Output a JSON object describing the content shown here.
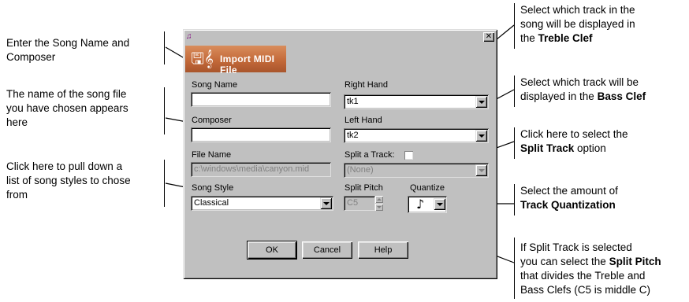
{
  "annotations": {
    "song_name": [
      "Enter the Song Name and",
      "Composer"
    ],
    "file_name": [
      "The name of the song file",
      "you have chosen appears",
      "here"
    ],
    "song_style": [
      "Click here to pull down a",
      "list of song styles to chose",
      "from"
    ],
    "treble_clef": {
      "line1": "Select which track in the",
      "line2": "song will be displayed in",
      "line3_prefix": "the ",
      "line3_bold": "Treble Clef"
    },
    "bass_clef": {
      "line1": "Select which track will be",
      "line2_prefix": "displayed in the ",
      "line2_bold": "Bass Clef"
    },
    "split_track": {
      "line1": "Click here to select the",
      "line2_bold": "Split Track",
      "line2_suffix": " option"
    },
    "quantize": {
      "line1": "Select the amount of",
      "line2_bold": "Track Quantization"
    },
    "split_pitch": {
      "line1": "If Split Track is selected",
      "line2_prefix": "you can select the ",
      "line2_bold": "Split Pitch",
      "line3": "that divides the Treble and",
      "line4": "Bass Clefs (C5 is middle C)"
    }
  },
  "dialog": {
    "title_icon": "app-icon",
    "close_glyph": "✕",
    "banner_icon": "floppy-disk-icon",
    "banner_glyph": "🖫𝄞",
    "banner_title": "Import MIDI File",
    "song_name_label": "Song Name",
    "song_name_value": "",
    "composer_label": "Composer",
    "composer_value": "",
    "file_name_label": "File Name",
    "file_name_value": "c:\\windows\\media\\canyon.mid",
    "song_style_label": "Song Style",
    "song_style_value": "Classical",
    "right_hand_label": "Right Hand",
    "right_hand_value": "tk1",
    "left_hand_label": "Left Hand",
    "left_hand_value": "tk2",
    "split_track_label": "Split a Track:",
    "split_track_checked": false,
    "split_track_value": "(None)",
    "split_pitch_label": "Split Pitch",
    "split_pitch_value": "C5",
    "quantize_label": "Quantize",
    "quantize_value": "♪",
    "ok_label": "OK",
    "cancel_label": "Cancel",
    "help_label": "Help"
  }
}
